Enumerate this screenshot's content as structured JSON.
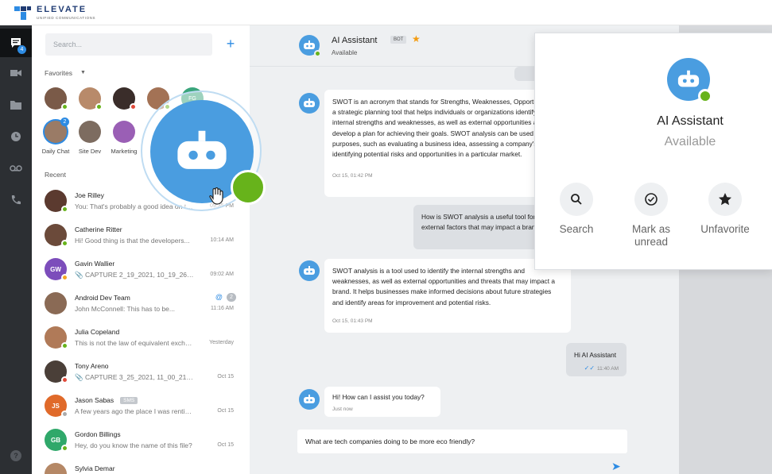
{
  "brand": {
    "name": "ELEVATE",
    "subtitle": "Unified Communications",
    "color": "#1f3b73"
  },
  "rail": {
    "items": [
      {
        "icon": "chat-icon",
        "badge": "4",
        "active": true
      },
      {
        "icon": "video-icon"
      },
      {
        "icon": "folder-icon"
      },
      {
        "icon": "clock-icon"
      },
      {
        "icon": "voicemail-icon"
      },
      {
        "icon": "phone-icon"
      }
    ],
    "help_label": "?"
  },
  "sidebar": {
    "search_placeholder": "Search...",
    "add_label": "+",
    "favorites_label": "Favorites",
    "favorites": [
      {
        "status": "#67b31b",
        "label": ""
      },
      {
        "status": "#67b31b",
        "label": ""
      },
      {
        "status": "#e04a3a",
        "label": ""
      },
      {
        "status": "#67b31b",
        "label": ""
      },
      {
        "status": "",
        "label": "",
        "initials": "FG"
      },
      {
        "status": "",
        "label": "Daily Chat",
        "badge": "2"
      },
      {
        "status": "",
        "label": "Site Dev"
      },
      {
        "status": "",
        "label": "Marketing"
      }
    ],
    "recent_label": "Recent",
    "conversations": [
      {
        "name": "Joe Rilley",
        "preview": "You: That's probably a good idea on th...",
        "time": "09:35 PM",
        "status": "#67b31b"
      },
      {
        "name": "Catherine Ritter",
        "preview": "Hi! Good thing is that the developers...",
        "time": "10:14 AM",
        "status": "#67b31b"
      },
      {
        "name": "Gavin Wallier",
        "initials": "GW",
        "preview": "CAPTURE 2_19_2021, 10_19_26.png",
        "time": "09:02 AM",
        "status": "#f5a623",
        "attachment": true
      },
      {
        "name": "Android Dev Team",
        "preview": "John McConnell: This has to be...",
        "time": "11:16 AM",
        "mention": "@",
        "count": "2"
      },
      {
        "name": "Julia Copeland",
        "preview": "This is not the law of equivalent exchange...",
        "time": "Yesterday",
        "status": "#67b31b"
      },
      {
        "name": "Tony Areno",
        "preview": "CAPTURE 3_25_2021, 11_00_21.png",
        "time": "Oct 15",
        "status": "#e04a3a",
        "attachment": true
      },
      {
        "name": "Jason Sabas",
        "initials": "JS",
        "sms_tag": "SMS",
        "preview": "A few years ago the place I was renting...",
        "time": "Oct 15",
        "status": "#aaaaaa"
      },
      {
        "name": "Gordon Billings",
        "initials": "GB",
        "preview": "Hey, do you know the name of this file?",
        "time": "Oct 15",
        "status": "#67b31b"
      },
      {
        "name": "Sylvia Demar",
        "preview": "",
        "time": "",
        "status": "#67b31b"
      }
    ]
  },
  "chat": {
    "name": "AI Assistant",
    "tag": "BOT",
    "status": "Available",
    "messages": [
      {
        "dir": "in",
        "text": "SWOT is an acronym that stands for Strengths, Weaknesses, Opportunities, and Threats. It is a strategic planning tool that helps individuals or organizations identify and analyze their internal strengths and weaknesses, as well as external opportunities and threats, in order to develop a plan for achieving their goals. SWOT analysis can be used for a variety of purposes, such as evaluating a business idea, assessing a company's performance, or identifying potential risks and opportunities in a particular market.",
        "time": "Oct 15, 01:42 PM"
      },
      {
        "dir": "out",
        "text": "How is SWOT analysis a useful tool for analyzing internal and external factors that may impact a brand?",
        "time": ""
      },
      {
        "dir": "in",
        "text": "SWOT analysis is a tool used to identify the internal strengths and weaknesses, as well as external opportunities and threats that may impact a brand. It helps businesses make informed decisions about future strategies and identify areas for improvement and potential risks.",
        "time": "Oct 15, 01:43 PM"
      },
      {
        "dir": "out",
        "text": "Hi AI Assistant",
        "time": "11:40 AM"
      },
      {
        "dir": "in",
        "text": "Hi! How can I assist you today?",
        "time": "Just now"
      }
    ],
    "composer_value": "What are tech companies doing to be more eco friendly?"
  },
  "card": {
    "name": "AI Assistant",
    "status": "Available",
    "actions": [
      {
        "label": "Search",
        "icon": "search-icon"
      },
      {
        "label": "Mark as unread",
        "icon": "check-circle-icon"
      },
      {
        "label": "Unfavorite",
        "icon": "star-icon"
      }
    ]
  },
  "colors": {
    "accent": "#2d8be3",
    "online": "#67b31b",
    "bot": "#4a9de0"
  }
}
